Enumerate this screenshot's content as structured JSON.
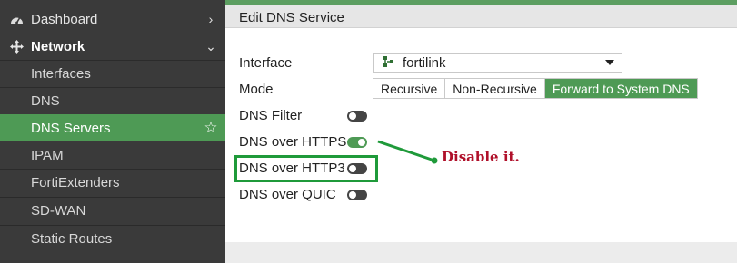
{
  "sidebar": {
    "dashboard": {
      "label": "Dashboard",
      "icon": "gauge-icon"
    },
    "network": {
      "label": "Network",
      "icon": "move-arrows-icon"
    },
    "sub_items": [
      {
        "label": "Interfaces"
      },
      {
        "label": "DNS"
      },
      {
        "label": "DNS Servers",
        "active": true
      },
      {
        "label": "IPAM"
      },
      {
        "label": "FortiExtenders"
      }
    ],
    "sections": [
      {
        "label": "SD-WAN"
      },
      {
        "label": "Static Routes"
      }
    ]
  },
  "header": {
    "title": "Edit DNS Service"
  },
  "form": {
    "interface": {
      "label": "Interface",
      "value": "fortilink",
      "icon": "fortilink-icon"
    },
    "mode": {
      "label": "Mode",
      "options": [
        "Recursive",
        "Non-Recursive",
        "Forward to System DNS"
      ],
      "selected": "Forward to System DNS"
    },
    "dns_filter": {
      "label": "DNS Filter",
      "enabled": false
    },
    "dns_over_https": {
      "label": "DNS over HTTPS",
      "enabled": true
    },
    "dns_over_http3": {
      "label": "DNS over HTTP3",
      "enabled": false
    },
    "dns_over_quic": {
      "label": "DNS over QUIC",
      "enabled": false
    }
  },
  "annotation": {
    "text": "Disable it.",
    "color": "#b0102a",
    "highlight_color": "#1f9a3a"
  },
  "colors": {
    "accent": "#4e9a55",
    "sidebar_bg": "#3a3a3a"
  }
}
